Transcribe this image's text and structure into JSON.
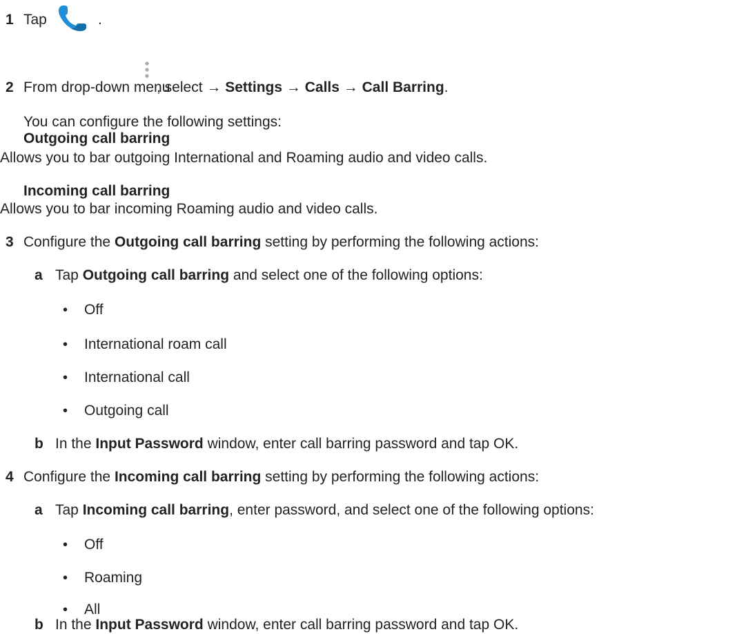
{
  "steps": {
    "s1": {
      "num": "1",
      "text": "Tap",
      "after": "."
    },
    "s2": {
      "num": "2",
      "text_pre": "From drop-down menu",
      "text_mid": ", select →",
      "settings": "Settings",
      "arrow1": "→",
      "calls": "Calls",
      "arrow2": "→",
      "call_barring": "Call Barring",
      "end": "."
    },
    "intro": "You can configure the following settings:",
    "outgoing_heading": "Outgoing call barring",
    "outgoing_desc": "Allows you to bar outgoing International and Roaming audio and video calls.",
    "incoming_heading": "Incoming call barring",
    "incoming_desc": "Allows you to bar incoming Roaming audio and video calls.",
    "s3": {
      "num": "3",
      "pre": "Configure the",
      "bold": "Outgoing call barring",
      "post": "setting by performing the following actions:",
      "a": {
        "letter": "a",
        "pre": "Tap",
        "bold": "Outgoing call barring",
        "post": "and select one of the following options:",
        "options": [
          "Off",
          "International roam call",
          "International call",
          "Outgoing call"
        ]
      },
      "b": {
        "letter": "b",
        "pre": "In the",
        "bold": "Input Password",
        "post": "window, enter call barring password and tap OK."
      }
    },
    "s4": {
      "num": "4",
      "pre": "Configure the",
      "bold": "Incoming call barring",
      "post": "setting by performing the following actions:",
      "a": {
        "letter": "a",
        "pre": "Tap",
        "bold": "Incoming call barring",
        "post": ", enter password, and select one of the following options:",
        "options": [
          "Off",
          "Roaming",
          "All"
        ]
      },
      "b": {
        "letter": "b",
        "pre": "In the",
        "bold": "Input Password",
        "post": "window, enter call barring password and tap OK."
      }
    }
  },
  "icons": {
    "phone": "phone-icon",
    "menu": "vertical-dots-icon",
    "phone_color": "#1e8fd6"
  },
  "bullet_char": "•"
}
